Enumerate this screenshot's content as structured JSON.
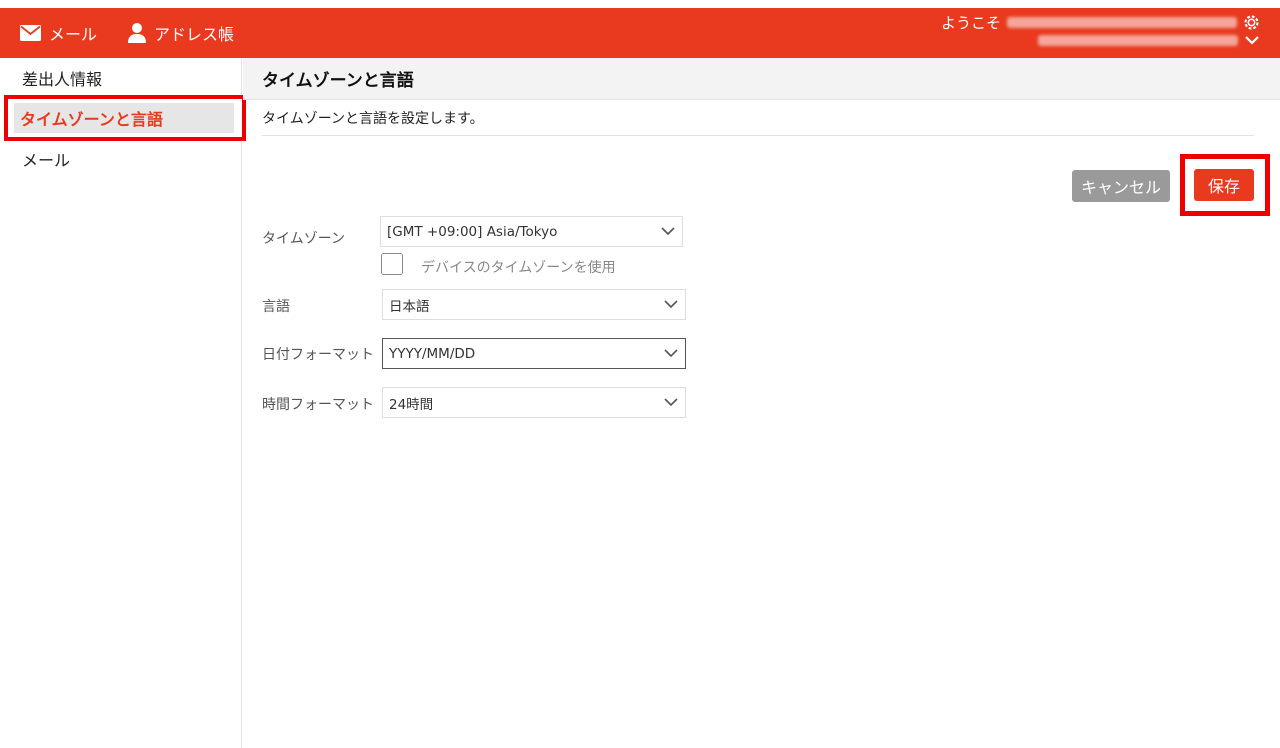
{
  "header": {
    "nav": [
      {
        "label": "メール",
        "icon": "mail-icon"
      },
      {
        "label": "アドレス帳",
        "icon": "person-icon"
      }
    ],
    "welcome_prefix": "ようこそ",
    "bg_color": "#e9391e"
  },
  "sidebar": {
    "items": [
      {
        "label": "差出人情報"
      },
      {
        "label": "タイムゾーンと言語"
      },
      {
        "label": "メール"
      }
    ],
    "active_index": 1
  },
  "main": {
    "title": "タイムゾーンと言語",
    "description": "タイムゾーンと言語を設定します。",
    "cancel_label": "キャンセル",
    "save_label": "保存",
    "form": {
      "timezone_label": "タイムゾーン",
      "timezone_value": "[GMT +09:00] Asia/Tokyo",
      "device_tz_label": "デバイスのタイムゾーンを使用",
      "device_tz_checked": false,
      "language_label": "言語",
      "language_value": "日本語",
      "date_format_label": "日付フォーマット",
      "date_format_value": "YYYY/MM/DD",
      "time_format_label": "時間フォーマット",
      "time_format_value": "24時間"
    }
  },
  "colors": {
    "accent": "#e9391e",
    "highlight_frame": "#ee0000",
    "cancel_bg": "#9a9a9a"
  }
}
